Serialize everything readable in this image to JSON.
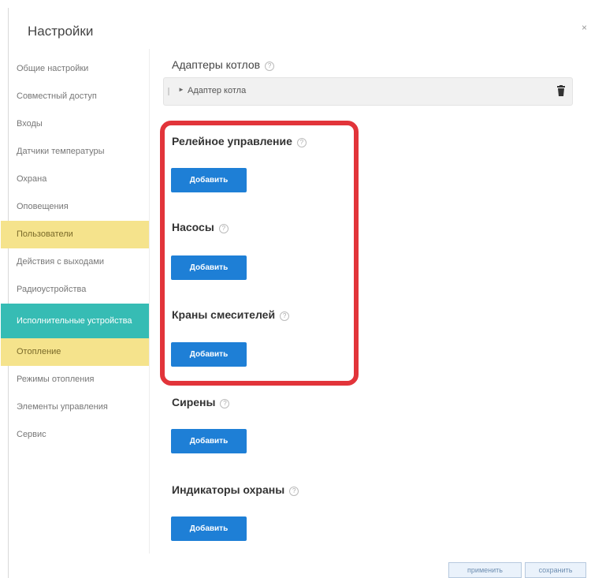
{
  "dialog": {
    "title": "Настройки",
    "close_label": "×"
  },
  "sidebar": {
    "items": [
      {
        "label": "Общие настройки",
        "state": "normal"
      },
      {
        "label": "Совместный доступ",
        "state": "normal"
      },
      {
        "label": "Входы",
        "state": "normal"
      },
      {
        "label": "Датчики температуры",
        "state": "normal"
      },
      {
        "label": "Охрана",
        "state": "normal"
      },
      {
        "label": "Оповещения",
        "state": "normal"
      },
      {
        "label": "Пользователи",
        "state": "highlighted"
      },
      {
        "label": "Действия с выходами",
        "state": "normal"
      },
      {
        "label": "Радиоустройства",
        "state": "normal"
      },
      {
        "label": "Исполнительные устройства",
        "state": "active"
      },
      {
        "label": "Отопление",
        "state": "highlighted"
      },
      {
        "label": "Режимы отопления",
        "state": "normal"
      },
      {
        "label": "Элементы управления",
        "state": "normal"
      },
      {
        "label": "Сервис",
        "state": "normal"
      }
    ]
  },
  "main": {
    "adapters": {
      "title": "Адаптеры котлов",
      "item_label": "Адаптер котла",
      "item_icon": "trash-icon"
    },
    "sections": [
      {
        "title": "Релейное управление",
        "button_label": "Добавить"
      },
      {
        "title": "Насосы",
        "button_label": "Добавить"
      },
      {
        "title": "Краны смесителей",
        "button_label": "Добавить"
      },
      {
        "title": "Сирены",
        "button_label": "Добавить"
      },
      {
        "title": "Индикаторы охраны",
        "button_label": "Добавить"
      }
    ]
  },
  "footer": {
    "apply_label": "применить",
    "save_label": "сохранить"
  },
  "colors": {
    "accent_button": "#1e7fd6",
    "active_item": "#36bcb4",
    "highlight_item": "#f5e38c",
    "annotation_frame": "#e2343a"
  }
}
